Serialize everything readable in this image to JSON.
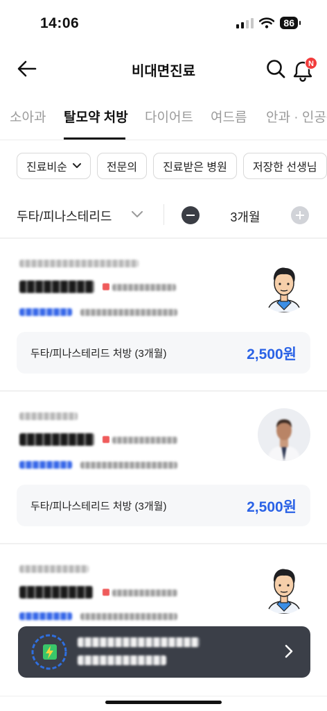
{
  "status_bar": {
    "time": "14:06",
    "battery": "86"
  },
  "header": {
    "title": "비대면진료",
    "notification_badge": "N"
  },
  "tabs": [
    {
      "label": "소아과"
    },
    {
      "label": "탈모약 처방"
    },
    {
      "label": "다이어트"
    },
    {
      "label": "여드름"
    },
    {
      "label": "안과 · 인공눈"
    }
  ],
  "filters": [
    {
      "label": "진료비순"
    },
    {
      "label": "전문의"
    },
    {
      "label": "진료받은 병원"
    },
    {
      "label": "저장한 선생님"
    }
  ],
  "option": {
    "drug": "두타/피나스테리드",
    "months": "3개월"
  },
  "cards": [
    {
      "price_label": "두타/피나스테리드 처방 (3개월)",
      "price": "2,500원",
      "avatar": "male-doctor-illustration"
    },
    {
      "price_label": "두타/피나스테리드 처방 (3개월)",
      "price": "2,500원",
      "avatar": "doctor-photo"
    },
    {
      "avatar": "male-doctor-illustration"
    }
  ],
  "colors": {
    "accent": "#2a62e6",
    "badge": "#f23c3c",
    "toast_bg": "#3b3f48"
  }
}
